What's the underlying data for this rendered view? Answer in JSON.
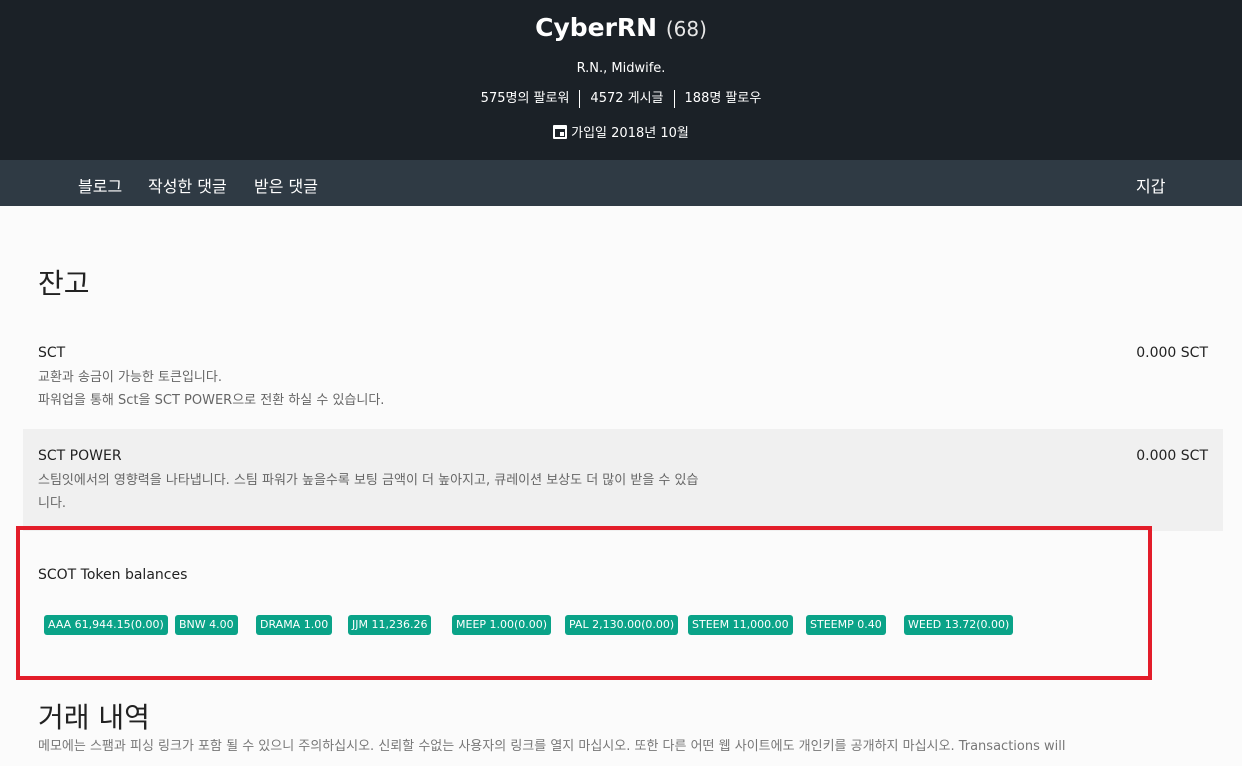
{
  "header": {
    "name": "CyberRN",
    "reputation": "(68)",
    "about": "R.N., Midwife.",
    "followers": "575명의 팔로워",
    "posts": "4572 게시글",
    "following": "188명 팔로우",
    "joined": "가입일 2018년 10월"
  },
  "nav": {
    "blog": "블로그",
    "comments": "작성한 댓글",
    "replies": "받은 댓글",
    "wallet": "지갑"
  },
  "balances": {
    "title": "잔고",
    "sct": {
      "name": "SCT",
      "desc1": "교환과 송금이 가능한 토큰입니다.",
      "desc2": "파워업을 통해 Sct을 SCT POWER으로 전환 하실 수 있습니다.",
      "amount": "0.000 SCT"
    },
    "sct_power": {
      "name": "SCT POWER",
      "desc1": "스팀잇에서의 영향력을 나타냅니다. 스팀 파워가 높을수록 보팅 금액이 더 높아지고, 큐레이션 보상도 더 많이 받을 수 있습",
      "desc2": "니다.",
      "amount": "0.000 SCT"
    }
  },
  "scot": {
    "title": "SCOT Token balances",
    "tokens": [
      {
        "label": "AAA 61,944.15(0.00)"
      },
      {
        "label": "BNW 4.00"
      },
      {
        "label": "DRAMA 1.00"
      },
      {
        "label": "JJM 11,236.26"
      },
      {
        "label": "MEEP 1.00(0.00)"
      },
      {
        "label": "PAL 2,130.00(0.00)"
      },
      {
        "label": "STEEM 11,000.00"
      },
      {
        "label": "STEEMP 0.40"
      },
      {
        "label": "WEED 13.72(0.00)"
      }
    ],
    "badge_color": "#0aa388",
    "highlight_color": "#e31d2a"
  },
  "transactions": {
    "title": "거래 내역",
    "desc": "메모에는 스팸과 피싱 링크가 포함 될 수 있으니 주의하십시오. 신뢰할 수없는 사용자의 링크를 열지 마십시오. 또한 다른 어떤 웹 사이트에도 개인키를 공개하지 마십시오. Transactions will"
  }
}
